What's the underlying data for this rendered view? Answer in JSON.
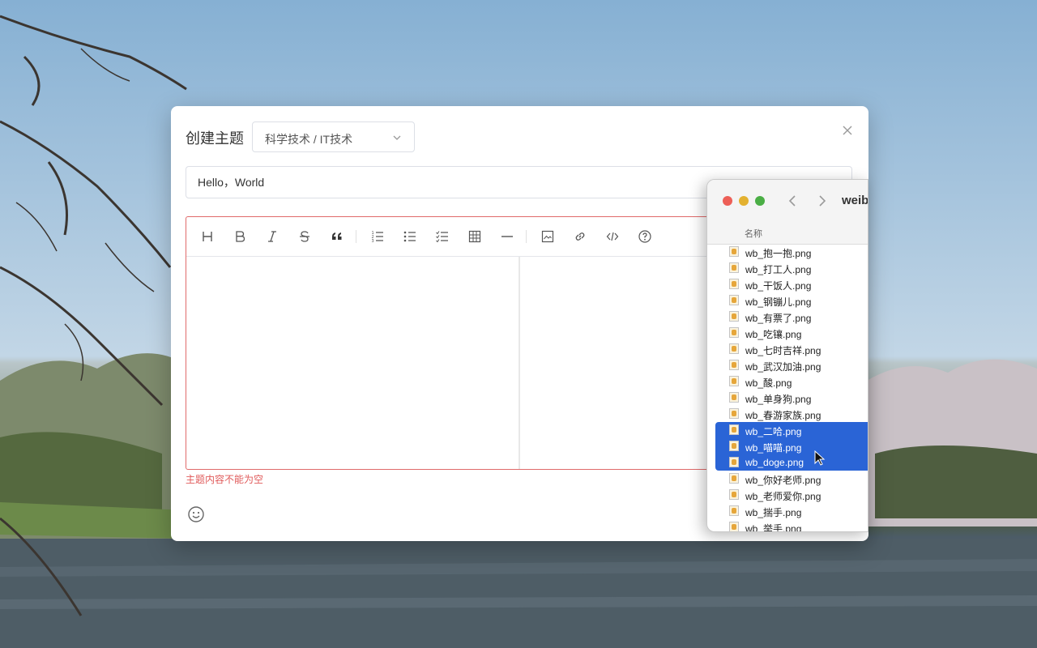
{
  "modal": {
    "title": "创建主题",
    "category": "科学技术 / IT技术",
    "title_input_value": "Hello，World",
    "error": "主题内容不能为空"
  },
  "toolbar": {
    "buttons": [
      "heading",
      "bold",
      "italic",
      "strikethrough",
      "quote",
      "ordered-list",
      "unordered-list",
      "task-list",
      "table",
      "horizontal-rule",
      "image",
      "link",
      "code",
      "help"
    ]
  },
  "finder": {
    "title": "weib",
    "column_header": "名称",
    "files": [
      {
        "name": "wb_抱一抱.png",
        "selected": false
      },
      {
        "name": "wb_打工人.png",
        "selected": false
      },
      {
        "name": "wb_干饭人.png",
        "selected": false
      },
      {
        "name": "wb_钢镚儿.png",
        "selected": false
      },
      {
        "name": "wb_有票了.png",
        "selected": false
      },
      {
        "name": "wb_吃镶.png",
        "selected": false
      },
      {
        "name": "wb_七时吉祥.png",
        "selected": false
      },
      {
        "name": "wb_武汉加油.png",
        "selected": false
      },
      {
        "name": "wb_酸.png",
        "selected": false
      },
      {
        "name": "wb_单身狗.png",
        "selected": false
      },
      {
        "name": "wb_春游家族.png",
        "selected": false
      },
      {
        "name": "wb_二哈.png",
        "selected": true
      },
      {
        "name": "wb_喵喵.png",
        "selected": true
      },
      {
        "name": "wb_doge.png",
        "selected": true
      },
      {
        "name": "wb_你好老师.png",
        "selected": false
      },
      {
        "name": "wb_老师爱你.png",
        "selected": false
      },
      {
        "name": "wb_揣手.png",
        "selected": false
      },
      {
        "name": "wb_举手.png",
        "selected": false
      }
    ]
  },
  "colors": {
    "selection": "#2a64d6",
    "error": "#e05b5b",
    "editor_border": "#e06a6a"
  }
}
